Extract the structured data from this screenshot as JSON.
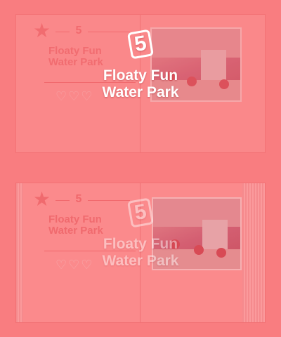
{
  "level": {
    "number": "5",
    "title_line1": "Floaty Fun",
    "title_line2": "Water Park"
  },
  "icons": {
    "star": "star-icon",
    "number_badge": "number-badge-icon",
    "heart": "heart-icon"
  },
  "colors": {
    "overlay_tint": "#f97d80",
    "text": "#ffffff"
  }
}
